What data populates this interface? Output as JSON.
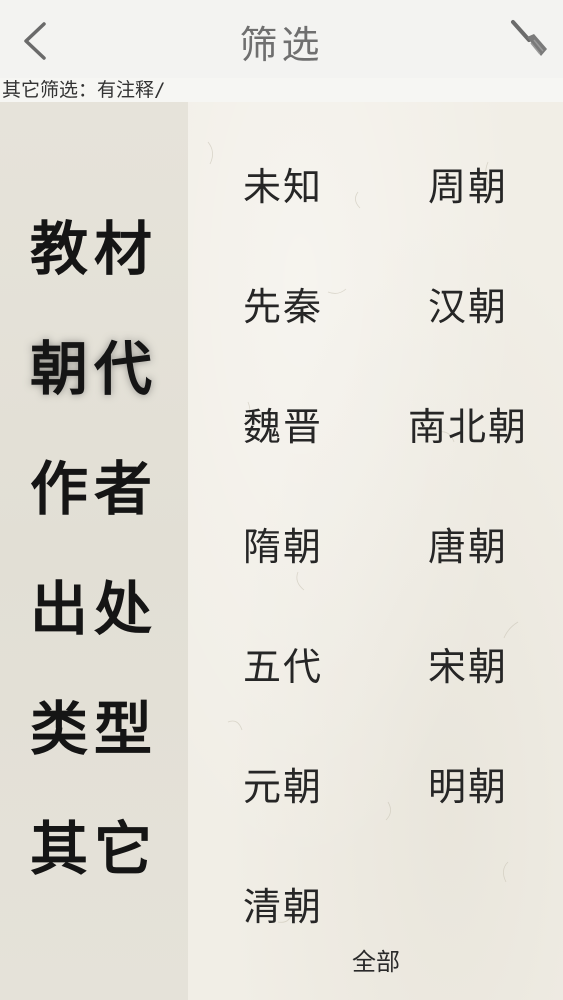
{
  "nav": {
    "title": "筛选"
  },
  "filter_summary": "其它筛选：有注释/",
  "sidebar": {
    "items": [
      {
        "label": "教材"
      },
      {
        "label": "朝代",
        "active": true
      },
      {
        "label": "作者"
      },
      {
        "label": "出处"
      },
      {
        "label": "类型"
      },
      {
        "label": "其它"
      }
    ]
  },
  "options": [
    "未知",
    "周朝",
    "先秦",
    "汉朝",
    "魏晋",
    "南北朝",
    "隋朝",
    "唐朝",
    "五代",
    "宋朝",
    "元朝",
    "明朝",
    "清朝"
  ],
  "all_label": "全部",
  "colors": {
    "nav_bg": "#f3f3f1",
    "sidebar_bg": "#e4e1d8",
    "paper_bg": "#f1eee6"
  }
}
